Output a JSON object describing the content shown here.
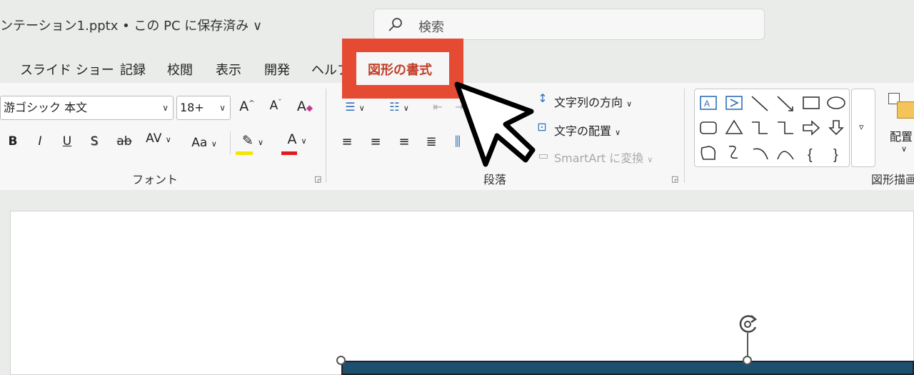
{
  "title_bar": {
    "doc_title": "ンテーション1.pptx • この PC に保存済み ∨"
  },
  "search": {
    "placeholder": "検索"
  },
  "tabs": [
    {
      "label": "スライド ショー"
    },
    {
      "label": "記録"
    },
    {
      "label": "校閲"
    },
    {
      "label": "表示"
    },
    {
      "label": "開発"
    },
    {
      "label": "ヘルプ"
    },
    {
      "label": "図形の書式"
    }
  ],
  "font_group": {
    "font_name": "游ゴシック 本文",
    "font_size": "18+",
    "label": "フォント",
    "buttons": {
      "grow": "A",
      "shrink": "A",
      "clear": "A",
      "bold": "B",
      "italic": "I",
      "underline": "U",
      "shadow": "S",
      "strike": "ab",
      "spacing": "AV",
      "case": "Aa",
      "font_color": "A"
    }
  },
  "paragraph_group": {
    "label": "段落",
    "text_direction": "文字列の方向",
    "align_text": "文字の配置",
    "smartart": "SmartArt に変換"
  },
  "drawing_group": {
    "label": "図形描画",
    "arrange": "配置"
  },
  "colors": {
    "highlight": "#e54a33",
    "active_tab_text": "#c0402a",
    "shape_fill": "#1d4f6e",
    "font_color_bar": "#e51919",
    "highlighter_bar": "#f2e600",
    "accent_blue": "#2f6fb5"
  },
  "cursor": {
    "icon": "arrow-pointer-icon"
  }
}
